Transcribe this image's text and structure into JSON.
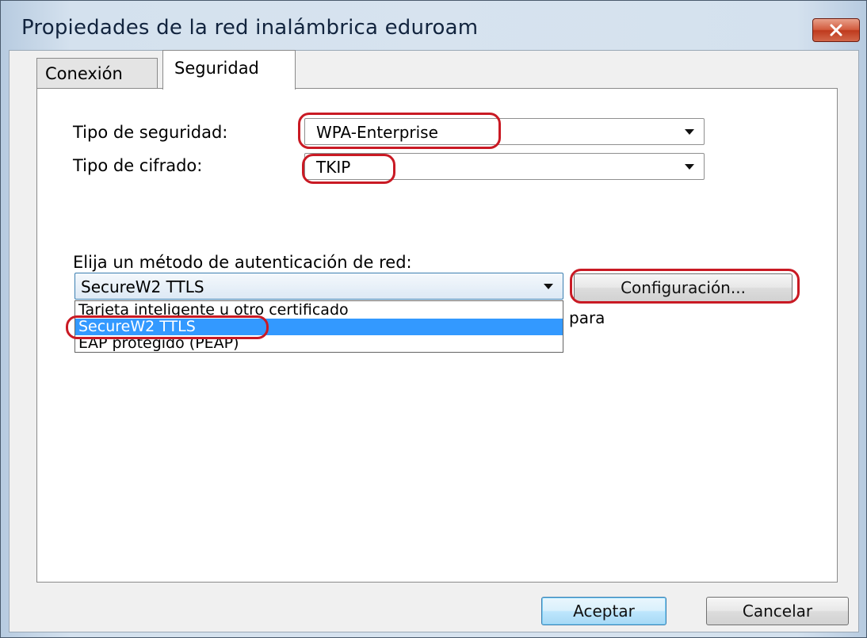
{
  "window": {
    "title": "Propiedades de la red inalámbrica eduroam",
    "close_icon": "close-x-icon"
  },
  "tabs": [
    {
      "label": "Conexión",
      "active": false
    },
    {
      "label": "Seguridad",
      "active": true
    }
  ],
  "security": {
    "security_type_label": "Tipo de seguridad:",
    "security_type_value": "WPA-Enterprise",
    "encryption_type_label": "Tipo de cifrado:",
    "encryption_type_value": "TKIP"
  },
  "auth": {
    "method_label": "Elija un método de autenticación de red:",
    "selected_method": "SecureW2 TTLS",
    "options": [
      "Tarjeta inteligente u otro certificado",
      "SecureW2 TTLS",
      "EAP protegido (PEAP)"
    ],
    "highlighted_option_index": 1,
    "settings_button": "Configuración...",
    "partial_text_behind_dropdown": "para"
  },
  "footer": {
    "ok_button": "Aceptar",
    "cancel_button": "Cancelar"
  },
  "colors": {
    "highlight_annotation": "#c91a24",
    "selection": "#3399ff"
  }
}
